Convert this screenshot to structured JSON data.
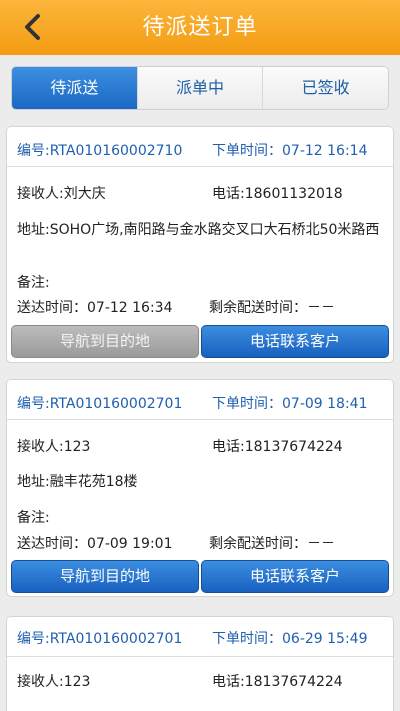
{
  "header": {
    "title": "待派送订单"
  },
  "tabs": [
    {
      "label": "待派送"
    },
    {
      "label": "派单中"
    },
    {
      "label": "已签收"
    }
  ],
  "orders": [
    {
      "number": "编号:RTA010160002710",
      "order_time": "下单时间：07-12 16:14",
      "receiver": "接收人:刘大庆",
      "phone": "电话:18601132018",
      "address": "地址:SOHO广场,南阳路与金水路交叉口大石桥北50米路西",
      "note": "备注:",
      "delivery_time": "送达时间：07-12 16:34",
      "remaining": "剩余配送时间：－－",
      "nav_button": "导航到目的地",
      "call_button": "电话联系客户"
    },
    {
      "number": "编号:RTA010160002701",
      "order_time": "下单时间：07-09 18:41",
      "receiver": "接收人:123",
      "phone": "电话:18137674224",
      "address": "地址:融丰花苑18楼",
      "note": "备注:",
      "delivery_time": "送达时间：07-09 19:01",
      "remaining": "剩余配送时间：－－",
      "nav_button": "导航到目的地",
      "call_button": "电话联系客户"
    },
    {
      "number": "编号:RTA010160002701",
      "order_time": "下单时间：06-29 15:49",
      "receiver": "接收人:123",
      "phone": "电话:18137674224"
    }
  ]
}
